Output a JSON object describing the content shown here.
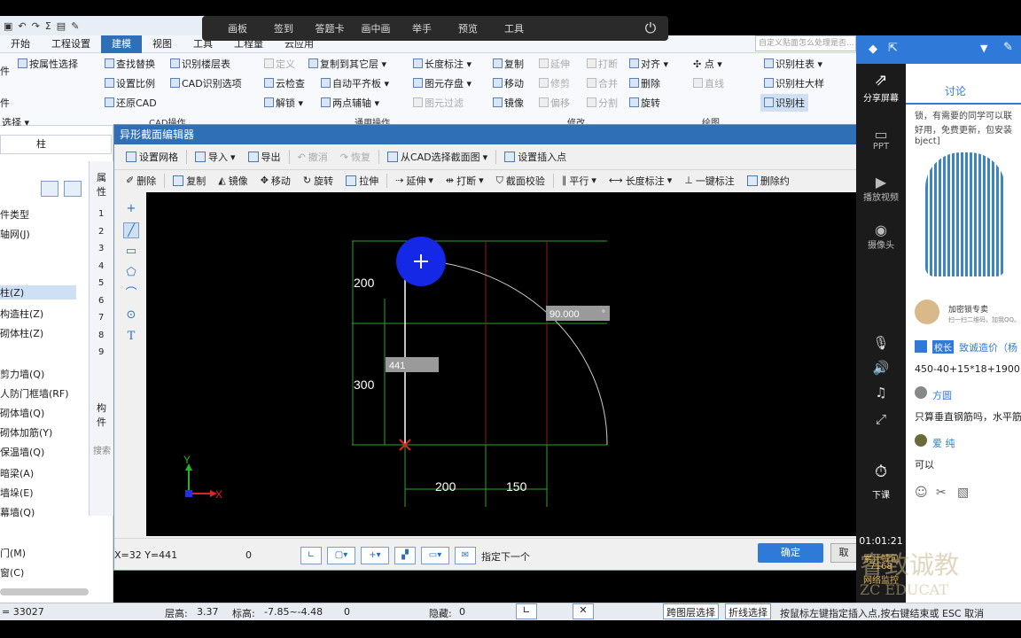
{
  "top_overlay": {
    "items": [
      "画板",
      "签到",
      "答题卡",
      "画中画",
      "举手",
      "预览",
      "工具"
    ]
  },
  "menubar": {
    "items": [
      "开始",
      "工程设置",
      "建模",
      "视图",
      "工具",
      "工程量",
      "云应用"
    ],
    "active": "建模",
    "search_placeholder": "自定义贴面怎么处理是否..."
  },
  "ribbon": {
    "buttons": {
      "by_attr_select": "按属性选择",
      "find_replace": "查找替换",
      "identify_floor_table": "识别楼层表",
      "set_scale": "设置比例",
      "cad_identify_options": "CAD识别选项",
      "restore_cad": "还原CAD",
      "define": "定义",
      "copy_to_other_layer": "复制到其它层",
      "length_dim": "长度标注",
      "cloud_check": "云检查",
      "auto_level_slab": "自动平齐板",
      "element_save": "图元存盘",
      "unlock": "解锁",
      "two_point_aux": "两点辅轴",
      "element_filter": "图元过滤",
      "copy": "复制",
      "extend": "延伸",
      "break": "打断",
      "align": "对齐",
      "move": "移动",
      "trim": "修剪",
      "merge": "合并",
      "delete": "删除",
      "mirror": "镜像",
      "offset": "偏移",
      "split": "分割",
      "rotate": "旋转",
      "point": "点",
      "rotate_line": "直线",
      "identify_col_table": "识别柱表",
      "identify_col_detail": "识别柱大样",
      "identify_col": "识别柱",
      "left_partial_1": "件",
      "left_partial_2": "件",
      "left_select": "选择"
    },
    "groups": {
      "cad_ops": "CAD操作",
      "general_ops": "通用操作",
      "modify": "修改",
      "draw": "绘图"
    }
  },
  "left_panel": {
    "dropdown": "柱",
    "items": [
      "件类型",
      "轴网(J)",
      "柱(Z)",
      "构造柱(Z)",
      "砌体柱(Z)",
      "剪力墙(Q)",
      "人防门框墙(RF)",
      "砌体墙(Q)",
      "砌体加筋(Y)",
      "保温墙(Q)",
      "暗梁(A)",
      "墙垛(E)",
      "幕墙(Q)",
      "门(M)",
      "窗(C)"
    ],
    "selected": "柱(Z)",
    "props_header": "属性",
    "props_rows": [
      "1",
      "2",
      "3",
      "4",
      "5",
      "6",
      "7",
      "8",
      "9"
    ],
    "comp_header": "构件",
    "comp_search": "搜索"
  },
  "dialog": {
    "title": "异形截面编辑器",
    "toolbar1": [
      "设置网格",
      "导入",
      "导出",
      "撤消",
      "恢复",
      "从CAD选择截面图",
      "设置插入点"
    ],
    "toolbar2": [
      "删除",
      "复制",
      "镜像",
      "移动",
      "旋转",
      "拉伸",
      "延伸",
      "打断",
      "截面校验",
      "平行",
      "长度标注",
      "一键标注",
      "删除约"
    ],
    "canvas": {
      "dim_200_v": "200",
      "dim_300_v": "300",
      "dim_200_h": "200",
      "dim_150_h": "150",
      "angle_input": "90.000",
      "angle_unit": "°",
      "len_input": "441",
      "axis_x": "X",
      "axis_y": "Y"
    },
    "coord_readout": "X=32 Y=441",
    "coord_zero": "0",
    "prompt": "指定下一个",
    "ok": "确定",
    "cancel_partial": "取"
  },
  "status_bar": {
    "left_value": "= 33027",
    "floor_height_label": "层高:",
    "floor_height": "3.37",
    "elevation_label": "标高:",
    "elevation": "-7.85~-4.48",
    "zero": "0",
    "hidden_label": "隐藏:",
    "hidden": "0",
    "cross_layer": "跨图层选择",
    "polyline_select": "折线选择",
    "hint": "按鼠标左键指定插入点,按右键结束或 ESC 取消"
  },
  "right_panel": {
    "tab": "讨论",
    "side_items": [
      "分享屏幕",
      "PPT",
      "播放视频",
      "摄像头",
      "下课"
    ],
    "timer": "01:01:21",
    "stats_label": "累计赞包",
    "stats_value": "7168",
    "net_label": "网络监控",
    "chat_text_1": "锁，有需要的同学可以联",
    "chat_text_2": "好用，免费更新，包安装",
    "chat_text_3": "bject]",
    "ad_name": "加密锁专卖",
    "ad_desc": "扫一扫二维码，加我QQ。",
    "msg1_badge": "校长",
    "msg1_user": "致诚造价（杨",
    "msg1_text": "450-40+15*18+1900",
    "msg2_user": "方圆",
    "msg2_text": "只算垂直钢筋吗，水平筋",
    "msg3_user": "爱 纯",
    "msg3_text": "可以"
  },
  "watermark": {
    "cn": "睿致诚教",
    "en": "ZC EDUCAT"
  }
}
